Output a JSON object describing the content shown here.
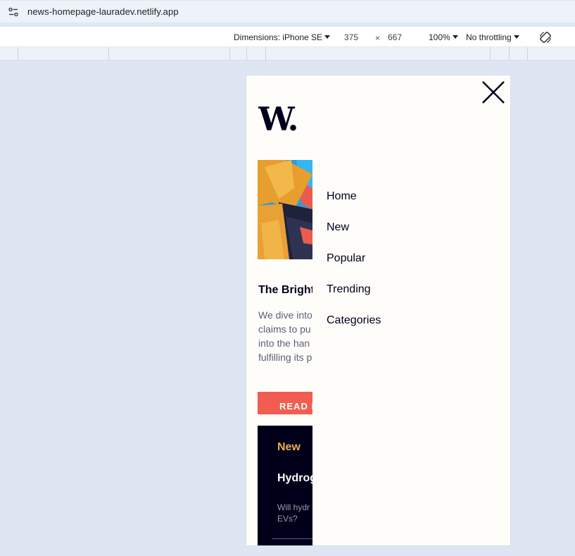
{
  "browser": {
    "url": "news-homepage-lauradev.netlify.app"
  },
  "devtools": {
    "dimensions_label": "Dimensions: iPhone SE",
    "width": "375",
    "times": "×",
    "height": "667",
    "zoom": "100%",
    "throttling": "No throttling"
  },
  "site": {
    "logo_text": "W.",
    "headline": "The Bright",
    "intro_lines": [
      "We dive into",
      "claims to pu",
      "into the han",
      "fulfilling its p"
    ],
    "read_more": "READ M",
    "new_section": {
      "title": "New",
      "item_title": "Hydrog",
      "item_lines": [
        "Will hydr",
        "EVs?"
      ]
    }
  },
  "menu": {
    "items": [
      "Home",
      "New",
      "Popular",
      "Trending",
      "Categories"
    ]
  },
  "colors": {
    "accent": "#f15d51",
    "dark": "#00001a",
    "gold": "#e9ab53",
    "offwhite": "#fffdfa"
  }
}
